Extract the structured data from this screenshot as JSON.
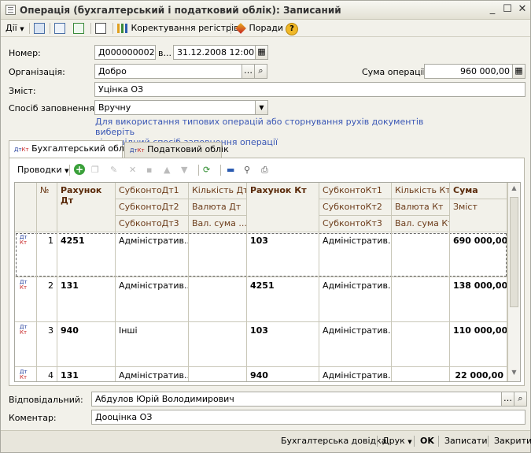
{
  "window": {
    "title": "Операція (бухгалтерський і податковий облік): Записаний",
    "minimize": "_",
    "maximize": "☐",
    "close": "✕"
  },
  "toolbar": {
    "actions_label": "Дії",
    "adjust_registers_label": "Коректування регістрів",
    "tips_label": "Поради",
    "help_label": "?"
  },
  "header": {
    "number_label": "Номер:",
    "number_value": "Д000000002",
    "date_sep": "в...",
    "date_value": "31.12.2008 12:00:00",
    "org_label": "Організація:",
    "org_value": "Добро",
    "sum_label": "Сума операції:",
    "sum_value": "960 000,00",
    "content_label": "Зміст:",
    "content_value": "Уцінка ОЗ",
    "fill_method_label": "Спосіб заповнення:",
    "fill_method_value": "Вручну",
    "hint_line1": "Для використання типових операцій або сторнування рухів документів виберіть",
    "hint_line2": "відповідний спосіб заповнення операції"
  },
  "tabs": [
    {
      "label": "Бухгалтерський облік"
    },
    {
      "label": "Податковий облік"
    }
  ],
  "grid_toolbar": {
    "entries_label": "Проводки"
  },
  "grid": {
    "headers": {
      "num": "№",
      "debit_account": "Рахунок Дт",
      "subkonto_dt1": "СубконтоДт1",
      "subkonto_dt2": "СубконтоДт2",
      "subkonto_dt3": "СубконтоДт3",
      "qty_dt": "Кількість Дт",
      "currency_dt": "Валюта Дт",
      "cur_sum_dt": "Вал. сума ...",
      "credit_account": "Рахунок Кт",
      "subkonto_kt1": "СубконтоКт1",
      "subkonto_kt2": "СубконтоКт2",
      "subkonto_kt3": "СубконтоКт3",
      "qty_kt": "Кількість Кт",
      "currency_kt": "Валюта Кт",
      "cur_sum_kt": "Вал. сума Кт",
      "sum": "Сума",
      "content": "Зміст"
    },
    "rows": [
      {
        "num": "1",
        "dt": "4251",
        "sub_dt1": "Адміністратив...",
        "kt": "103",
        "sub_kt1": "Адміністратив...",
        "sum": "690 000,00"
      },
      {
        "num": "2",
        "dt": "131",
        "sub_dt1": "Адміністратив...",
        "kt": "4251",
        "sub_kt1": "Адміністратив...",
        "sum": "138 000,00"
      },
      {
        "num": "3",
        "dt": "940",
        "sub_dt1": "Інші",
        "kt": "103",
        "sub_kt1": "Адміністратив...",
        "sum": "110 000,00"
      },
      {
        "num": "4",
        "dt": "131",
        "sub_dt1": "Адміністратив...",
        "kt": "940",
        "sub_kt1": "Адміністратив...",
        "sum": "22 000,00"
      }
    ],
    "row_icon_top": "Дт",
    "row_icon_bottom": "Кт"
  },
  "footer_fields": {
    "responsible_label": "Відповідальний:",
    "responsible_value": "Абдулов Юрій Володимирович",
    "comment_label": "Коментар:",
    "comment_value": "Дооцінка ОЗ"
  },
  "bottom_bar": {
    "accounting_report": "Бухгалтерська довідка",
    "print": "Друк",
    "ok": "OK",
    "save": "Записати",
    "close": "Закрити"
  },
  "colors": {
    "accent_link": "#3a57b5",
    "header_text": "#5a2a0a"
  }
}
